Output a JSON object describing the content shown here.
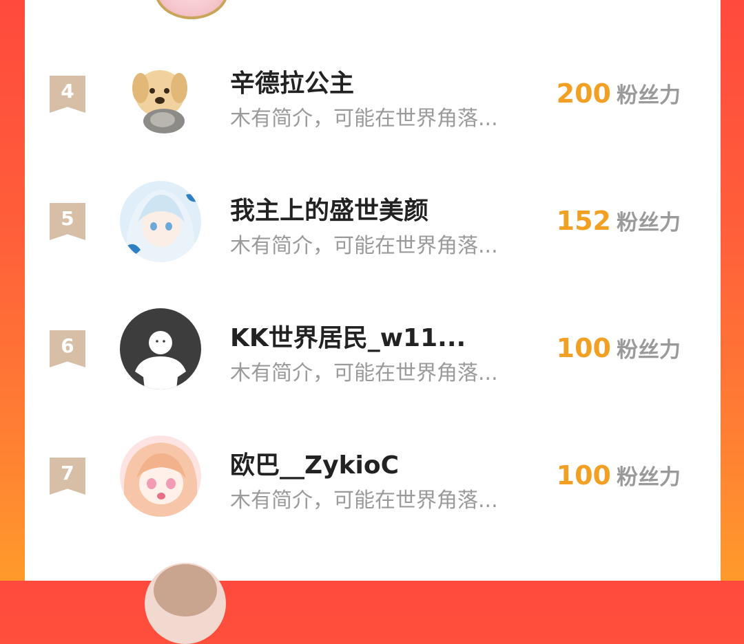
{
  "colors": {
    "background_gradient": [
      "#ff4a3d",
      "#ff9a2b"
    ],
    "rank_badge": "#d6bfa6",
    "fans_number": "#f2a024",
    "name": "#222222",
    "muted": "#9a9a9a"
  },
  "list": {
    "rows": [
      {
        "rank": "4",
        "name": "辛德拉公主",
        "bio": "木有简介，可能在世界角落...",
        "fans": "200",
        "fans_label": "粉丝力",
        "avatar": "puppy-kitten-avatar"
      },
      {
        "rank": "5",
        "name": "我主上的盛世美颜",
        "bio": "木有简介，可能在世界角落...",
        "fans": "152",
        "fans_label": "粉丝力",
        "avatar": "anime-girl-avatar"
      },
      {
        "rank": "6",
        "name": "KK世界居民_w11...",
        "bio": "木有简介，可能在世界角落...",
        "fans": "100",
        "fans_label": "粉丝力",
        "avatar": "default-person-avatar"
      },
      {
        "rank": "7",
        "name": "欧巴__ZykioC",
        "bio": "木有简介，可能在世界角落...",
        "fans": "100",
        "fans_label": "粉丝力",
        "avatar": "anime-girl-avatar"
      }
    ]
  }
}
